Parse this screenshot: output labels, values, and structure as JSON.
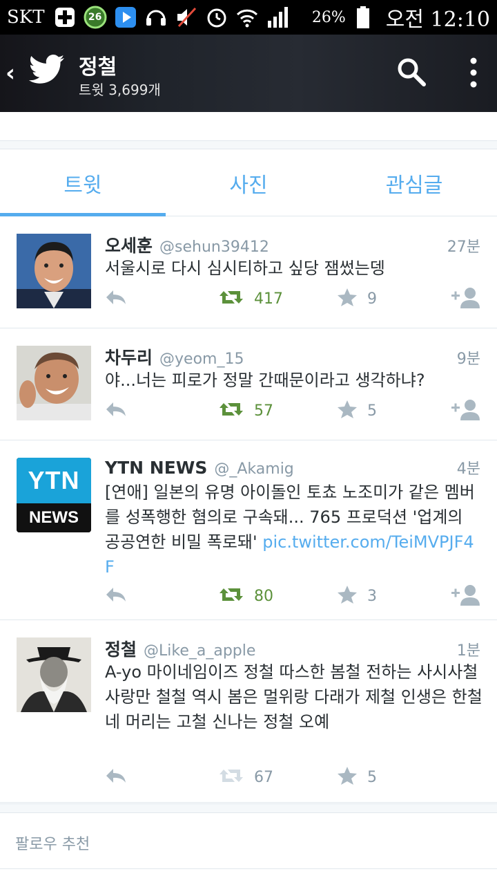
{
  "status_bar": {
    "carrier": "SKT",
    "notification_count": "26",
    "battery_percent": "26%",
    "time": "오전 12:10"
  },
  "header": {
    "title": "정철",
    "subtitle": "트윗 3,699개"
  },
  "tabs": [
    {
      "label": "트윗",
      "active": true
    },
    {
      "label": "사진",
      "active": false
    },
    {
      "label": "관심글",
      "active": false
    }
  ],
  "tweets": [
    {
      "name": "오세훈",
      "handle": "@sehun39412",
      "time": "27분",
      "text": "서울시로 다시 심시티하고 싶당 잼썼는뎅",
      "retweets": "417",
      "favorites": "9"
    },
    {
      "name": "차두리",
      "handle": "@yeom_15",
      "time": "9분",
      "text": "야...너는 피로가 정말 간때문이라고 생각하냐?",
      "retweets": "57",
      "favorites": "5"
    },
    {
      "name": "YTN NEWS",
      "handle": "@_Akamig",
      "time": "4분",
      "text": "[연애] 일본의 유명 아이돌인 토쵸 노조미가 같은 멤버를 성폭행한 혐의로 구속돼... 765 프로덕션 '업계의 공공연한 비밀 폭로돼' ",
      "link": "pic.twitter.com/TeiMVPJF4F",
      "retweets": "80",
      "favorites": "3",
      "avatar_top": "YTN",
      "avatar_bottom": "NEWS"
    },
    {
      "name": "정철",
      "handle": "@Like_a_apple",
      "time": "1분",
      "text": "A-yo 마이네임이즈 정철 따스한 봄철 전하는 사시사철 사랑만 철철 역시 봄은 멀위랑 다래가 제철 인생은 한철 네 머리는 고철 신나는 정철 오예",
      "retweets": "67",
      "favorites": "5"
    }
  ],
  "suggestions": {
    "label": "팔로우 추천"
  },
  "colors": {
    "accent": "#55acee",
    "retweet_green": "#5c913b",
    "muted": "#8899a6",
    "text": "#292f33"
  },
  "icons": [
    "back-icon",
    "twitter-bird-icon",
    "search-icon",
    "more-icon",
    "reply-icon",
    "retweet-icon",
    "star-icon",
    "follow-icon"
  ]
}
